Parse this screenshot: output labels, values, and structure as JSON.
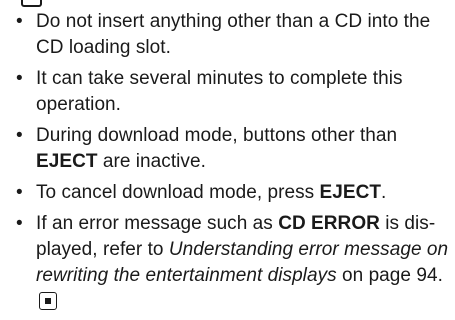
{
  "notes": [
    {
      "text": "Do not insert anything other than a CD into the CD loading slot."
    },
    {
      "text": "It can take several minutes to complete this operation."
    },
    {
      "before": "During download mode, buttons other than ",
      "bold": "EJECT",
      "after": " are inactive."
    },
    {
      "before": "To cancel download mode, press ",
      "bold": "EJECT",
      "after": "."
    },
    {
      "before": "If an error message such as ",
      "bold": "CD ERROR",
      "middle": " is dis-played, refer to ",
      "italic": "Understanding error message on rewriting the entertainment displays",
      "after": " on page 94."
    }
  ],
  "icons": {
    "top": "note-icon",
    "end": "end-of-section-icon"
  }
}
